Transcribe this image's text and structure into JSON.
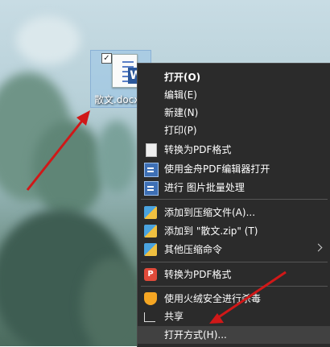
{
  "desktop_file": {
    "name": "散文.docx"
  },
  "context_menu": {
    "items": [
      {
        "label": "打开(O)"
      },
      {
        "label": "编辑(E)"
      },
      {
        "label": "新建(N)"
      },
      {
        "label": "打印(P)"
      },
      {
        "label": "转换为PDF格式",
        "icon": "document-icon"
      },
      {
        "label": "使用金舟PDF编辑器打开",
        "icon": "pdf-editor-icon"
      },
      {
        "label": "进行 图片批量处理",
        "icon": "image-batch-icon"
      },
      {
        "label": "添加到压缩文件(A)...",
        "icon": "archive-icon"
      },
      {
        "label": "添加到 \"散文.zip\" (T)",
        "icon": "archive-icon"
      },
      {
        "label": "其他压缩命令",
        "icon": "archive-icon"
      },
      {
        "label": "转换为PDF格式",
        "icon": "pdf-icon"
      },
      {
        "label": "使用火绒安全进行杀毒",
        "icon": "shield-icon"
      },
      {
        "label": "共享",
        "icon": "share-icon"
      },
      {
        "label": "打开方式(H)..."
      }
    ]
  },
  "colors": {
    "menu_bg": "#2b2b2b",
    "menu_hover": "#414141",
    "accent_arrow": "#d01818"
  }
}
